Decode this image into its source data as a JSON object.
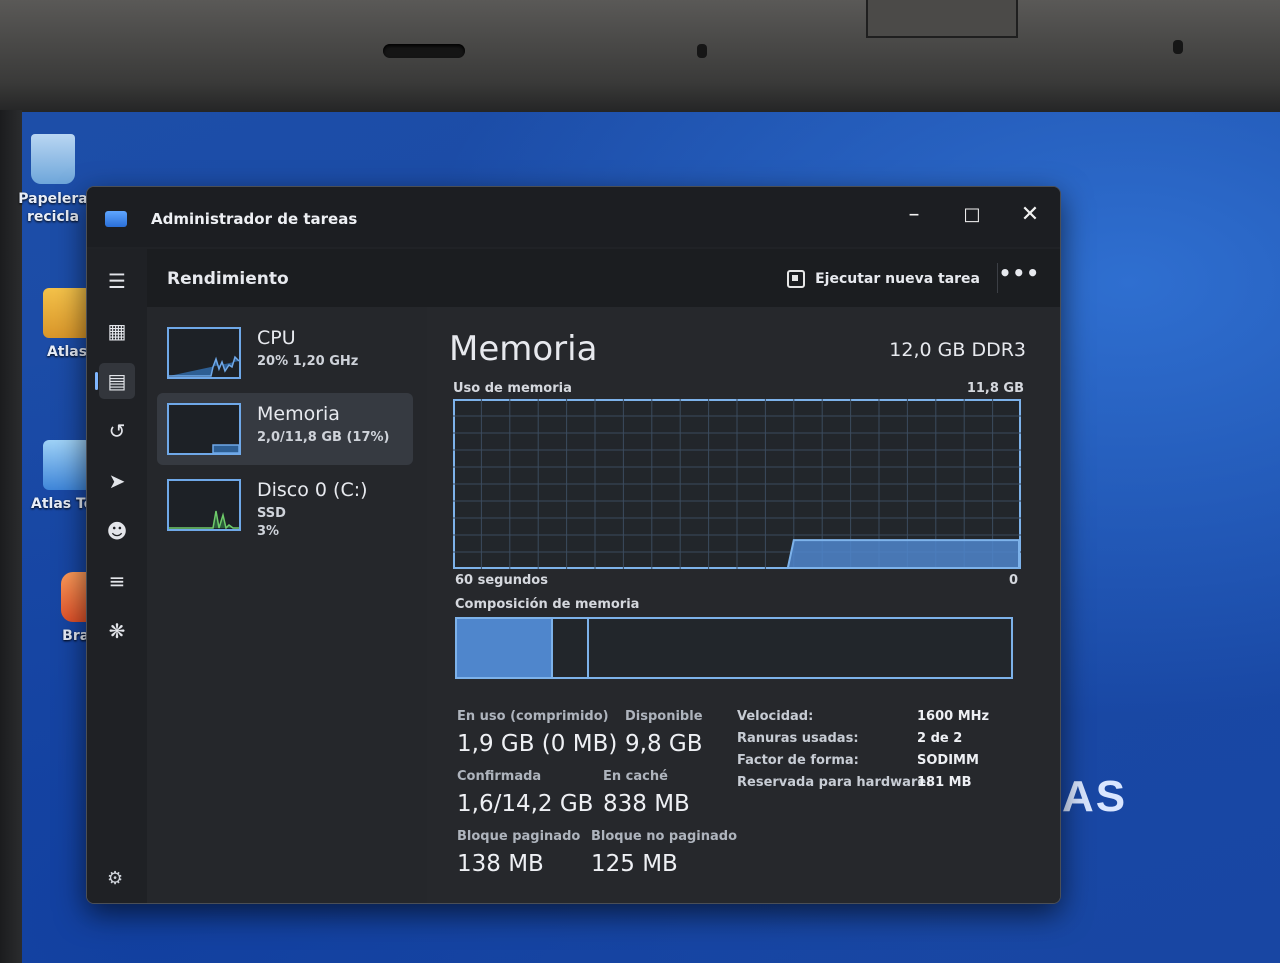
{
  "window": {
    "title": "Administrador de tareas"
  },
  "toolbar": {
    "section": "Rendimiento",
    "run_new_task": "Ejecutar nueva tarea",
    "more": "•••"
  },
  "desktop_icons": [
    {
      "label": "Papelera\nrecicla"
    },
    {
      "label": "Atlas"
    },
    {
      "label": "Atlas Too"
    },
    {
      "label": "Brave"
    }
  ],
  "wallpaper_text": "AS",
  "perf_items": [
    {
      "name": "CPU",
      "sub1": "20%  1,20 GHz",
      "sub2": ""
    },
    {
      "name": "Memoria",
      "sub1": "2,0/11,8 GB (17%)",
      "sub2": ""
    },
    {
      "name": "Disco 0 (C:)",
      "sub1": "SSD",
      "sub2": "3%"
    }
  ],
  "memory": {
    "title": "Memoria",
    "spec": "12,0 GB DDR3",
    "usage_label": "Uso de memoria",
    "usage_max": "11,8 GB",
    "graph_x_left": "60 segundos",
    "graph_x_right": "0",
    "composition_label": "Composición de memoria",
    "usage_fraction": 0.17,
    "in_use": {
      "label": "En uso (comprimido)",
      "value": "1,9 GB (0 MB)"
    },
    "available": {
      "label": "Disponible",
      "value": "9,8 GB"
    },
    "committed": {
      "label": "Confirmada",
      "value": "1,6/14,2 GB"
    },
    "cached": {
      "label": "En caché",
      "value": "838 MB"
    },
    "paged_pool": {
      "label": "Bloque paginado",
      "value": "138 MB"
    },
    "nonpaged_pool": {
      "label": "Bloque no paginado",
      "value": "125 MB"
    },
    "speed": {
      "label": "Velocidad:",
      "value": "1600 MHz"
    },
    "slots": {
      "label": "Ranuras usadas:",
      "value": "2 de 2"
    },
    "form_factor": {
      "label": "Factor de forma:",
      "value": "SODIMM"
    },
    "reserved": {
      "label": "Reservada para hardware:",
      "value": "181 MB"
    }
  },
  "colors": {
    "accent": "#7db2ea",
    "fill": "#4f86cc"
  }
}
